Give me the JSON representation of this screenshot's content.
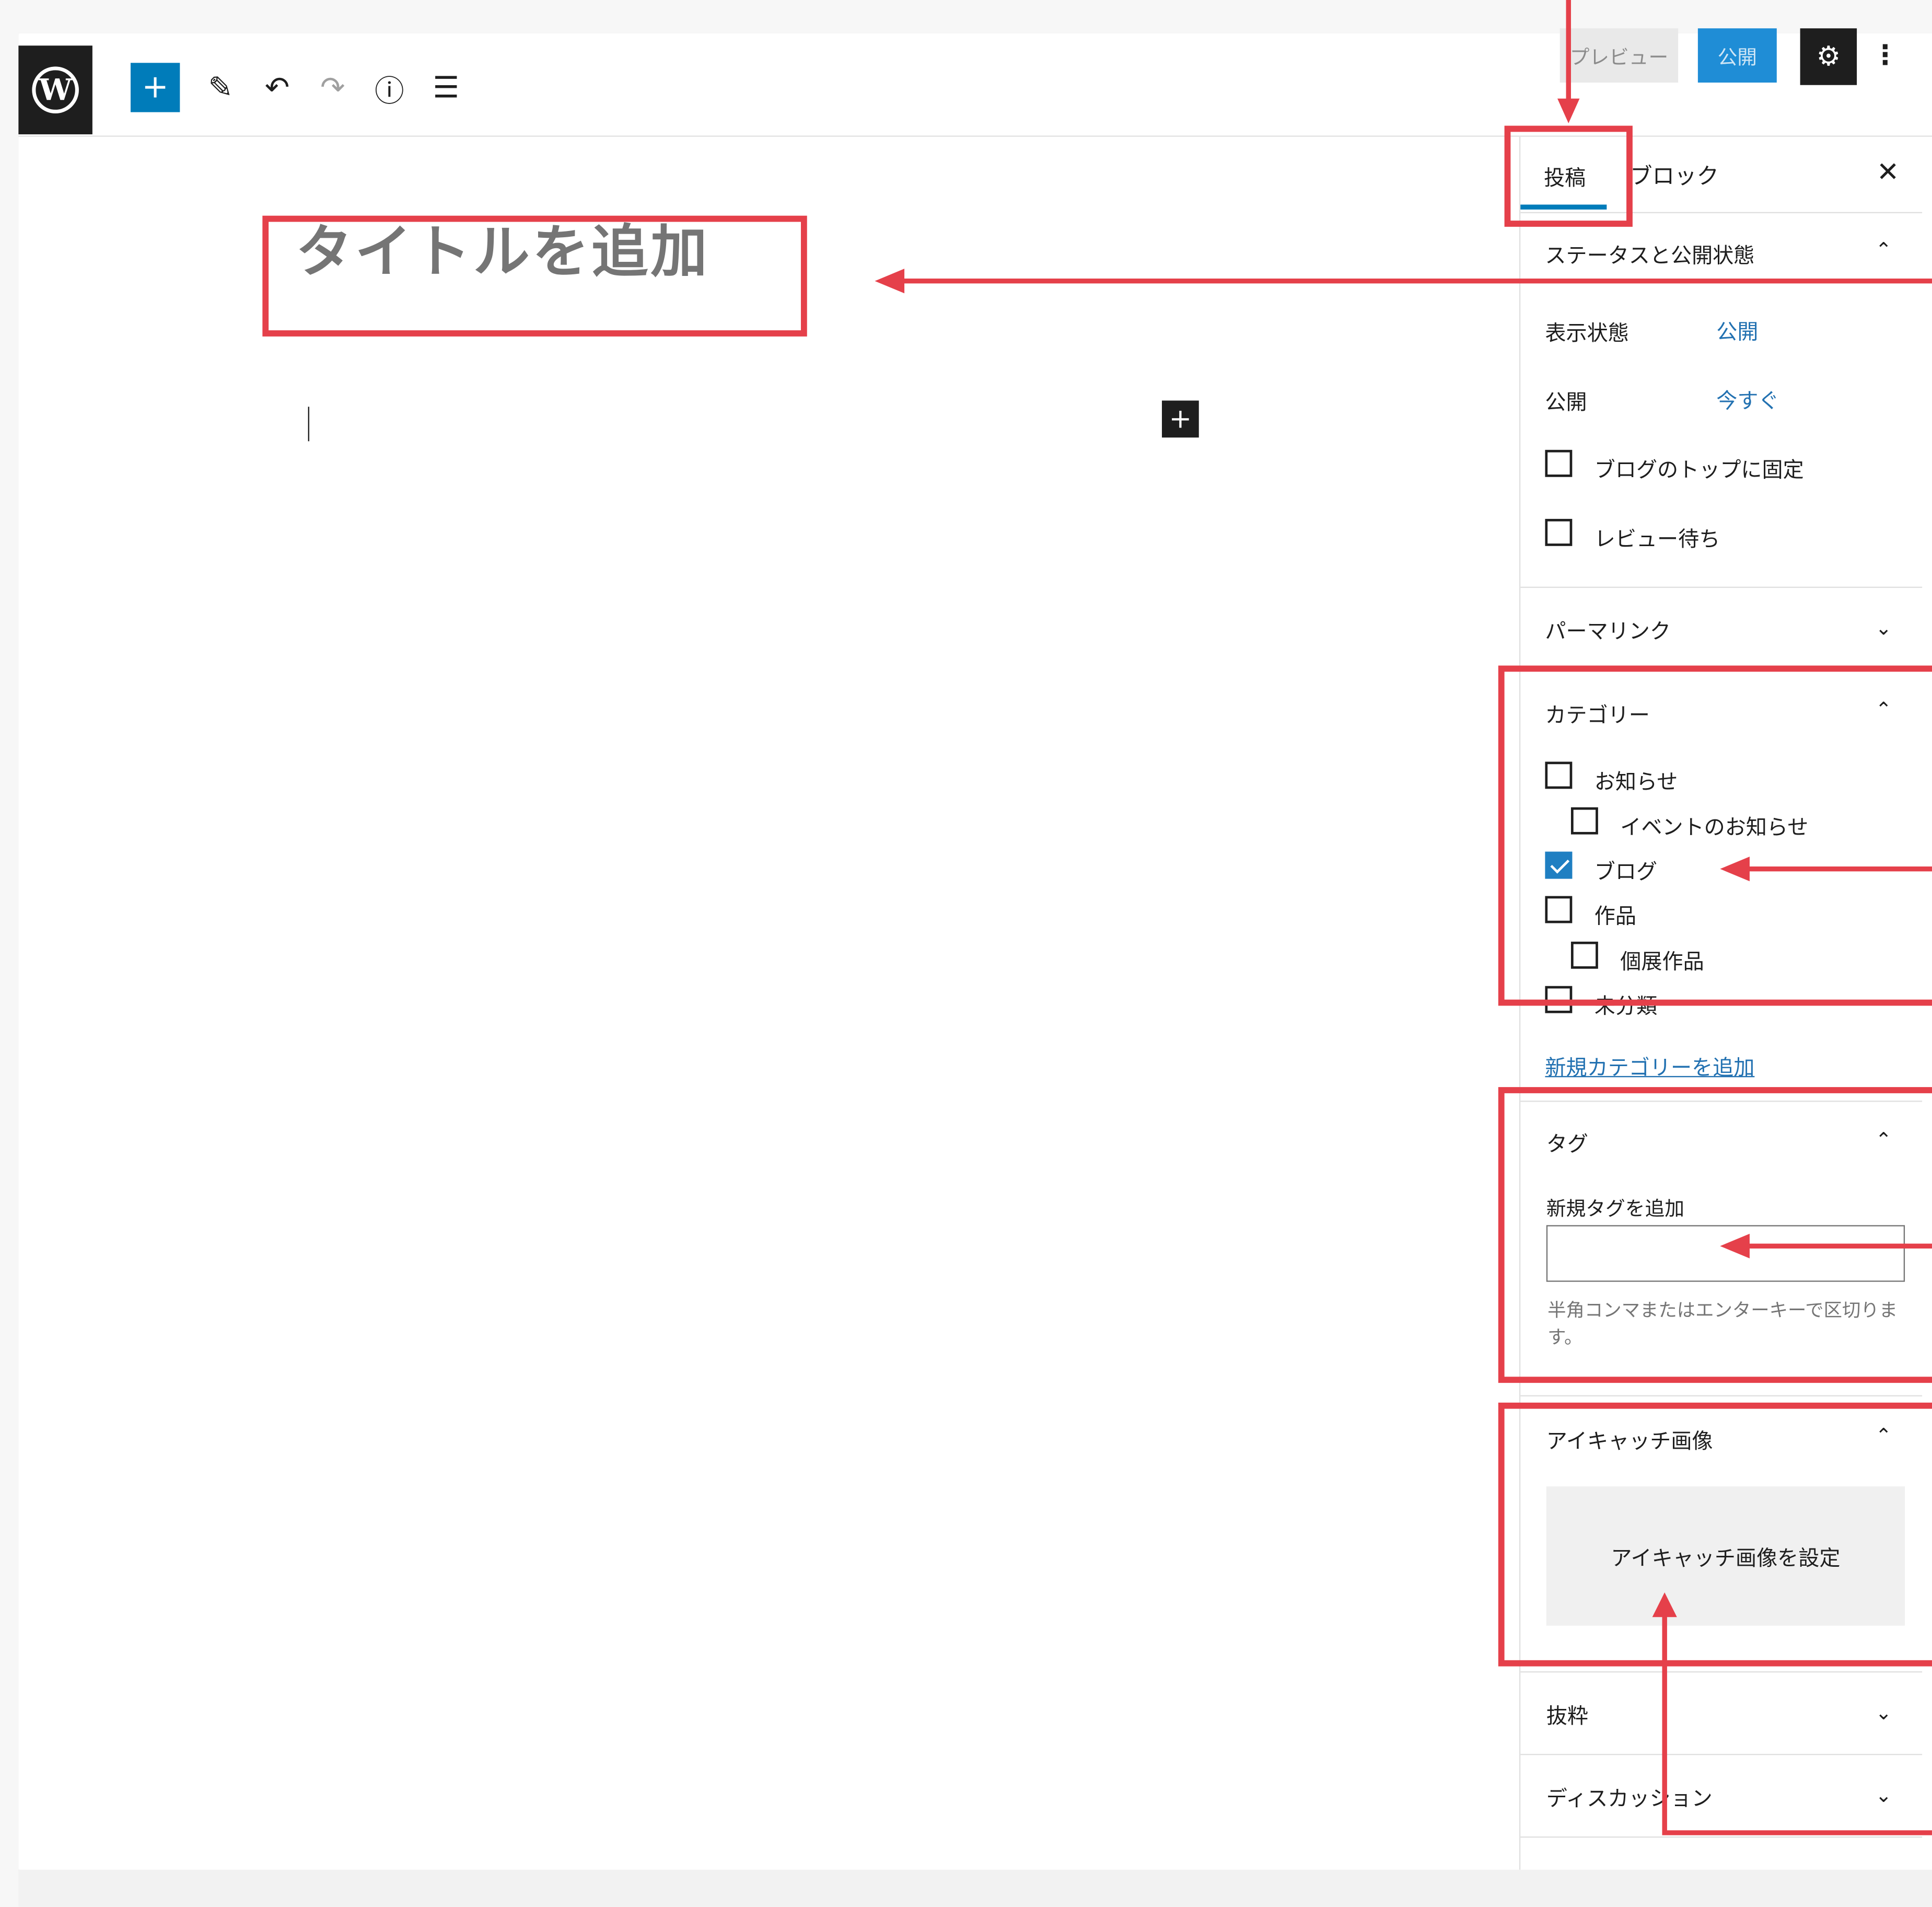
{
  "toolbar": {
    "logo_letter": "W",
    "add_icon": "+",
    "edit_icon": "✎",
    "undo_icon": "↶",
    "redo_icon": "↷",
    "info_icon": "ⓘ",
    "outline_icon": "☰",
    "preview_label": "プレビュー",
    "publish_label": "公開",
    "settings_icon": "⚙",
    "more_icon": "⋮"
  },
  "editor": {
    "title_placeholder": "タイトルを追加",
    "block_add_icon": "+"
  },
  "sidebar": {
    "tabs": {
      "post": "投稿",
      "block": "ブロック"
    },
    "close_icon": "✕",
    "status": {
      "heading": "ステータスと公開状態",
      "visibility_label": "表示状態",
      "visibility_value": "公開",
      "publish_label": "公開",
      "publish_value": "今すぐ",
      "sticky_label": "ブログのトップに固定",
      "pending_label": "レビュー待ち"
    },
    "permalink": {
      "heading": "パーマリンク"
    },
    "categories": {
      "heading": "カテゴリー",
      "items": [
        {
          "label": "お知らせ",
          "checked": false
        },
        {
          "label": "イベントのお知らせ",
          "checked": false
        },
        {
          "label": "ブログ",
          "checked": true
        },
        {
          "label": "作品",
          "checked": false
        },
        {
          "label": "個展作品",
          "checked": false
        },
        {
          "label": "未分類",
          "checked": false
        }
      ],
      "add_new_link": "新規カテゴリーを追加"
    },
    "tags": {
      "heading": "タグ",
      "input_label": "新規タグを追加",
      "input_value": "",
      "help_text": "半角コンマまたはエンターキーで区切ります。"
    },
    "featured_image": {
      "heading": "アイキャッチ画像",
      "set_button": "アイキャッチ画像を設定"
    },
    "excerpt": {
      "heading": "抜粋"
    },
    "discussion": {
      "heading": "ディスカッション"
    },
    "chevron_up": "⌃",
    "chevron_down": "⌄"
  },
  "colors": {
    "accent": "#007cba",
    "annotation_red": "#e5404a",
    "publish_button": "#1f8dd6"
  }
}
